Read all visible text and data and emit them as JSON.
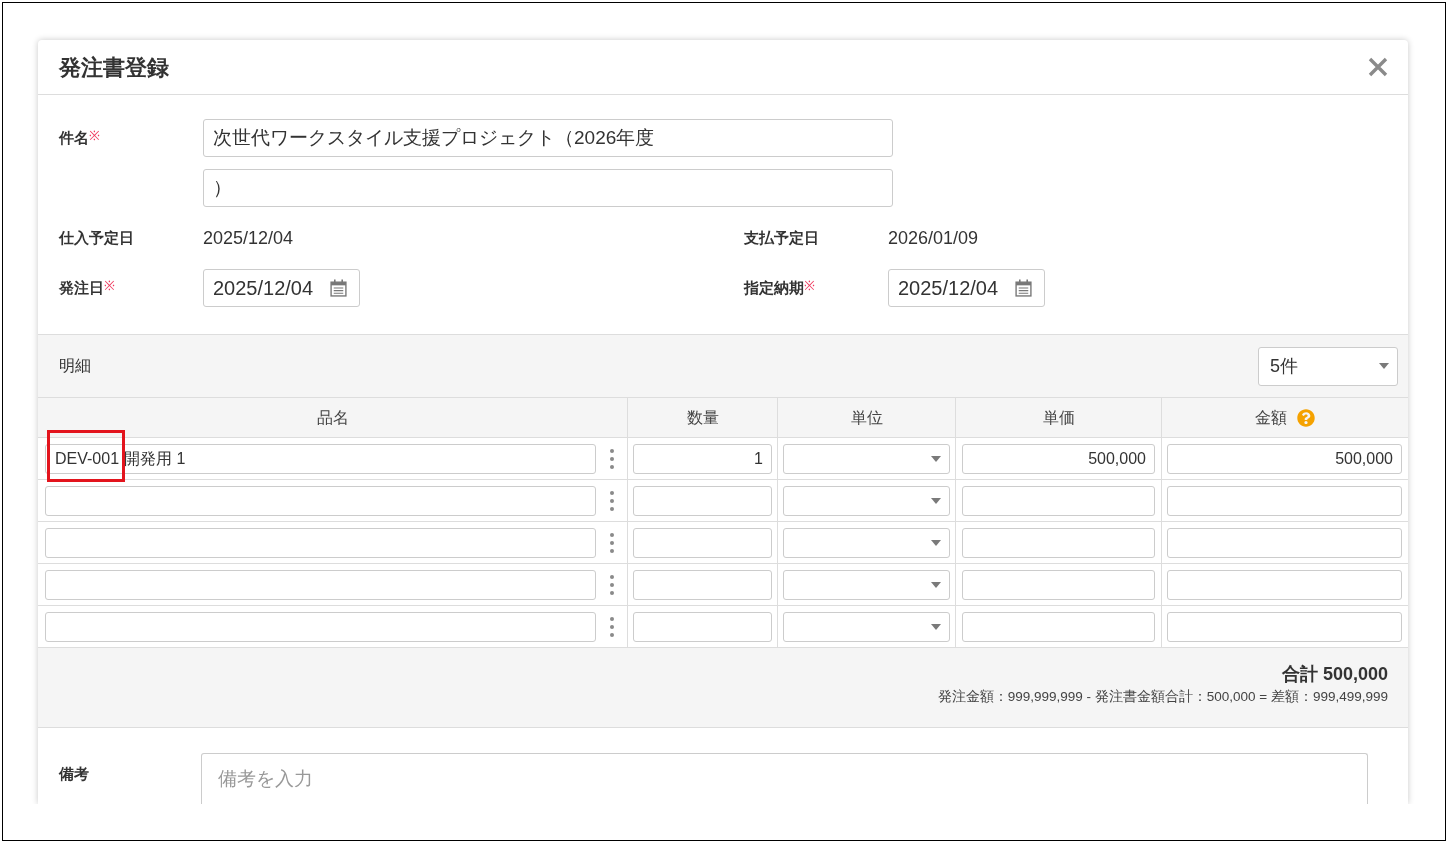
{
  "dialog": {
    "title": "発注書登録",
    "subject": {
      "label": "件名",
      "required_mark": "※",
      "lines": [
        "次世代ワークスタイル支援プロジェクト（2026年度",
        "）"
      ]
    },
    "date_rows": [
      [
        {
          "kind": "static",
          "label": "仕入予定日",
          "value": "2025/12/04"
        },
        {
          "kind": "static",
          "label": "支払予定日",
          "value": "2026/01/09"
        }
      ],
      [
        {
          "kind": "date",
          "label": "発注日",
          "required_mark": "※",
          "value": "2025/12/04"
        },
        {
          "kind": "date",
          "label": "指定納期",
          "required_mark": "※",
          "value": "2025/12/04"
        }
      ]
    ],
    "details": {
      "title": "明細",
      "page_size": "5件",
      "columns": [
        {
          "label": "品名",
          "help": false
        },
        {
          "label": "数量",
          "help": false
        },
        {
          "label": "単位",
          "help": false
        },
        {
          "label": "単価",
          "help": false
        },
        {
          "label": "金額",
          "help": true
        }
      ],
      "rows": [
        {
          "item_code": "DEV-001",
          "item_name": "開発用 1",
          "item_highlighted": true,
          "quantity": "1",
          "unit_price": "500,000",
          "amount": "500,000"
        },
        {
          "item_highlighted": false
        },
        {
          "item_highlighted": false
        },
        {
          "item_highlighted": false
        },
        {
          "item_highlighted": false
        }
      ],
      "total": "合計 500,000",
      "summary": "発注金額：999,999,999 - 発注書金額合計：500,000 = 差額：999,499,999"
    },
    "remarks": {
      "label": "備考",
      "placeholder": "備考を入力"
    }
  }
}
